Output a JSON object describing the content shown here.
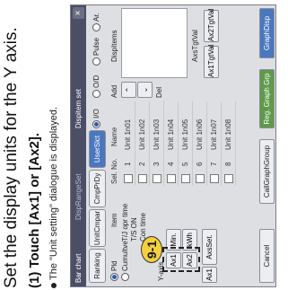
{
  "instructions": {
    "heading": "Set the display units for the Y axis.",
    "step": "(1) Touch [Ax1] or [Ax2].",
    "note": "The \"Unit setting\" dialogue is displayed."
  },
  "dialog": {
    "title_left": "Bar chart",
    "title_mid": "DispRangeSet",
    "title_right": "Dispitem set",
    "close_glyph": "×",
    "tabs": {
      "ranking": "Ranking",
      "unit_cmpar": "UnitCmpar",
      "cmp_by_day": "CmpPrDy",
      "user_set": "UserSlct"
    },
    "display_radios": {
      "od": "O/D",
      "pulse": "Pulse",
      "ar": "Ar.",
      "io": "I/O"
    },
    "plot_radios": {
      "pld": "Pld",
      "cumultve": "Cumultve"
    },
    "item_header": "Item",
    "items": [
      "T/J opr time",
      "T/S ON",
      "Con time"
    ],
    "yaxis_label": "Y-axis",
    "unit_buttons": {
      "ax1": "Ax1",
      "ax2": "Ax2",
      "min": "Min.",
      "kwh": "kWh",
      "ax1_set": "Ax1",
      "axs_set": "AxsSet."
    },
    "callout": "9-1",
    "table_headers": {
      "sel": "Sel.",
      "no": "No.",
      "name": "Name"
    },
    "rows": [
      {
        "no": "1",
        "name": "Unit 1n01"
      },
      {
        "no": "2",
        "name": "Unit 1n02"
      },
      {
        "no": "3",
        "name": "Unit 1n03"
      },
      {
        "no": "4",
        "name": "Unit 1n04"
      },
      {
        "no": "5",
        "name": "Unit 1n05"
      },
      {
        "no": "6",
        "name": "Unit 1n06"
      },
      {
        "no": "7",
        "name": "Unit 1n07"
      },
      {
        "no": "8",
        "name": "Unit 1n08"
      }
    ],
    "add_label": "Add",
    "del_label": "Del",
    "dispitems_label": "DispItems",
    "axis_val_label": "AxsTgtVal",
    "ax1_tgt": "Ax1TgtVal",
    "ax2_tgt": "Ax2TgtVal",
    "bottom": {
      "cancel": "Cancel",
      "call_graph_group": "CallGraphGroup",
      "reg_graph_grp": "Reg. Graph Grp",
      "graph_disp": "GraphDisp"
    }
  }
}
